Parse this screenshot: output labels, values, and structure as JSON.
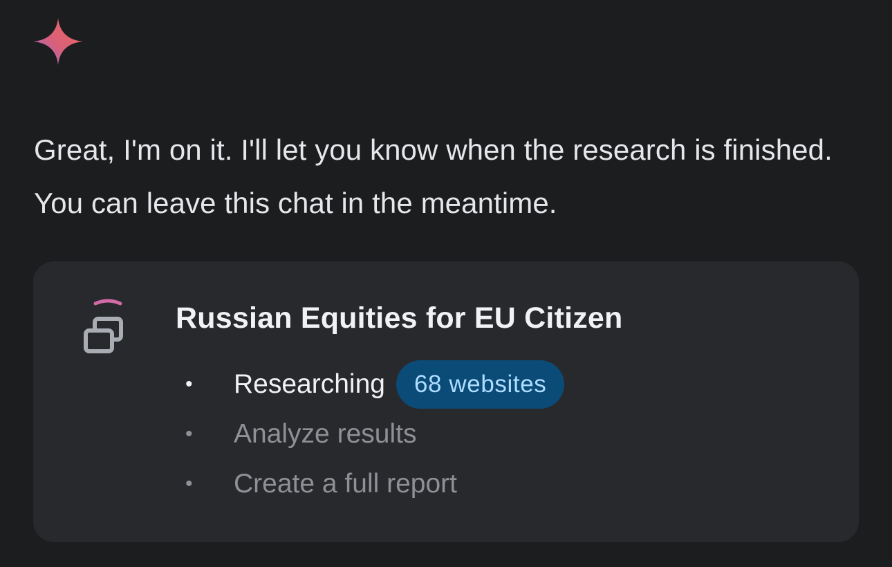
{
  "assistant": {
    "icon": "gemini-spark-icon",
    "message": "Great, I'm on it. I'll let you know when the research is finished. You can leave this chat in the meantime."
  },
  "research_card": {
    "icon": "stacked-windows-icon",
    "title": "Russian Equities for EU Citizen",
    "steps": [
      {
        "label": "Researching",
        "badge": "68 websites",
        "state": "active"
      },
      {
        "label": "Analyze results",
        "state": "pending"
      },
      {
        "label": "Create a full report",
        "state": "pending"
      }
    ]
  },
  "colors": {
    "background": "#1c1d1f",
    "card": "#28292c",
    "badge_bg": "#0b4b78",
    "badge_text": "#aeddff",
    "accent_arc": "#d36aa8",
    "pending_text": "#8e9095"
  }
}
